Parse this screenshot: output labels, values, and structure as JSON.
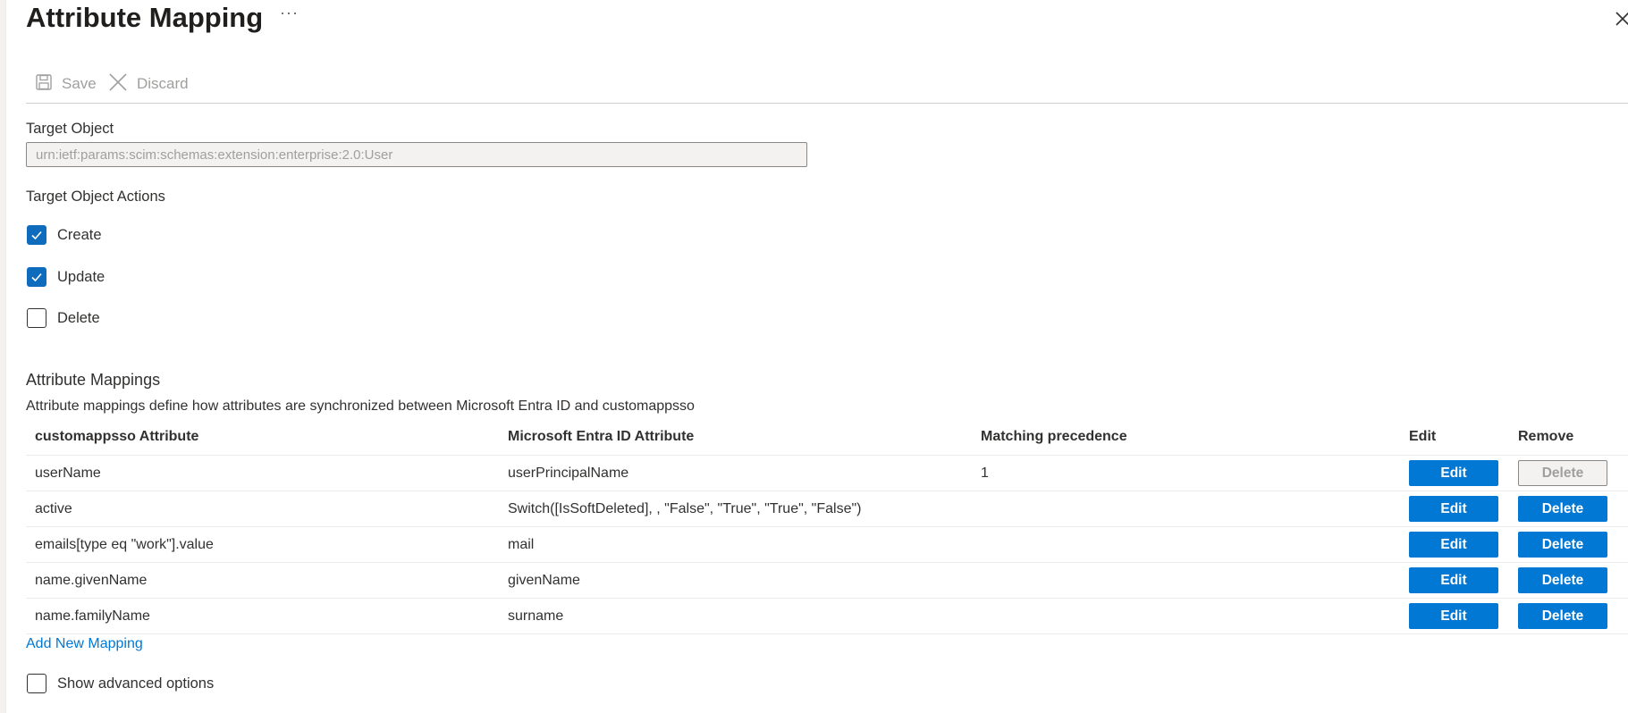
{
  "header": {
    "title": "Attribute Mapping",
    "more_label": "···"
  },
  "toolbar": {
    "save_label": "Save",
    "discard_label": "Discard"
  },
  "target_object": {
    "label": "Target Object",
    "value": "urn:ietf:params:scim:schemas:extension:enterprise:2.0:User"
  },
  "actions": {
    "label": "Target Object Actions",
    "items": [
      {
        "label": "Create",
        "checked": true
      },
      {
        "label": "Update",
        "checked": true
      },
      {
        "label": "Delete",
        "checked": false
      }
    ]
  },
  "mappings": {
    "title": "Attribute Mappings",
    "description": "Attribute mappings define how attributes are synchronized between Microsoft Entra ID and customappsso",
    "columns": [
      "customappsso Attribute",
      "Microsoft Entra ID Attribute",
      "Matching precedence",
      "Edit",
      "Remove"
    ],
    "rows": [
      {
        "target": "userName",
        "source": "userPrincipalName",
        "precedence": "1",
        "edit": "Edit",
        "remove": "Delete",
        "remove_disabled": true
      },
      {
        "target": "active",
        "source": "Switch([IsSoftDeleted], , \"False\", \"True\", \"True\", \"False\")",
        "precedence": "",
        "edit": "Edit",
        "remove": "Delete",
        "remove_disabled": false
      },
      {
        "target": "emails[type eq \"work\"].value",
        "source": "mail",
        "precedence": "",
        "edit": "Edit",
        "remove": "Delete",
        "remove_disabled": false
      },
      {
        "target": "name.givenName",
        "source": "givenName",
        "precedence": "",
        "edit": "Edit",
        "remove": "Delete",
        "remove_disabled": false
      },
      {
        "target": "name.familyName",
        "source": "surname",
        "precedence": "",
        "edit": "Edit",
        "remove": "Delete",
        "remove_disabled": false
      }
    ],
    "add_link": "Add New Mapping",
    "advanced_label": "Show advanced options",
    "advanced_checked": false
  },
  "colors": {
    "primary": "#0078d4",
    "checkbox_checked": "#0f6cbd",
    "disabled_bg": "#f3f2f1"
  },
  "icons": [
    "save-icon",
    "close-icon",
    "check-icon",
    "more-icon"
  ]
}
